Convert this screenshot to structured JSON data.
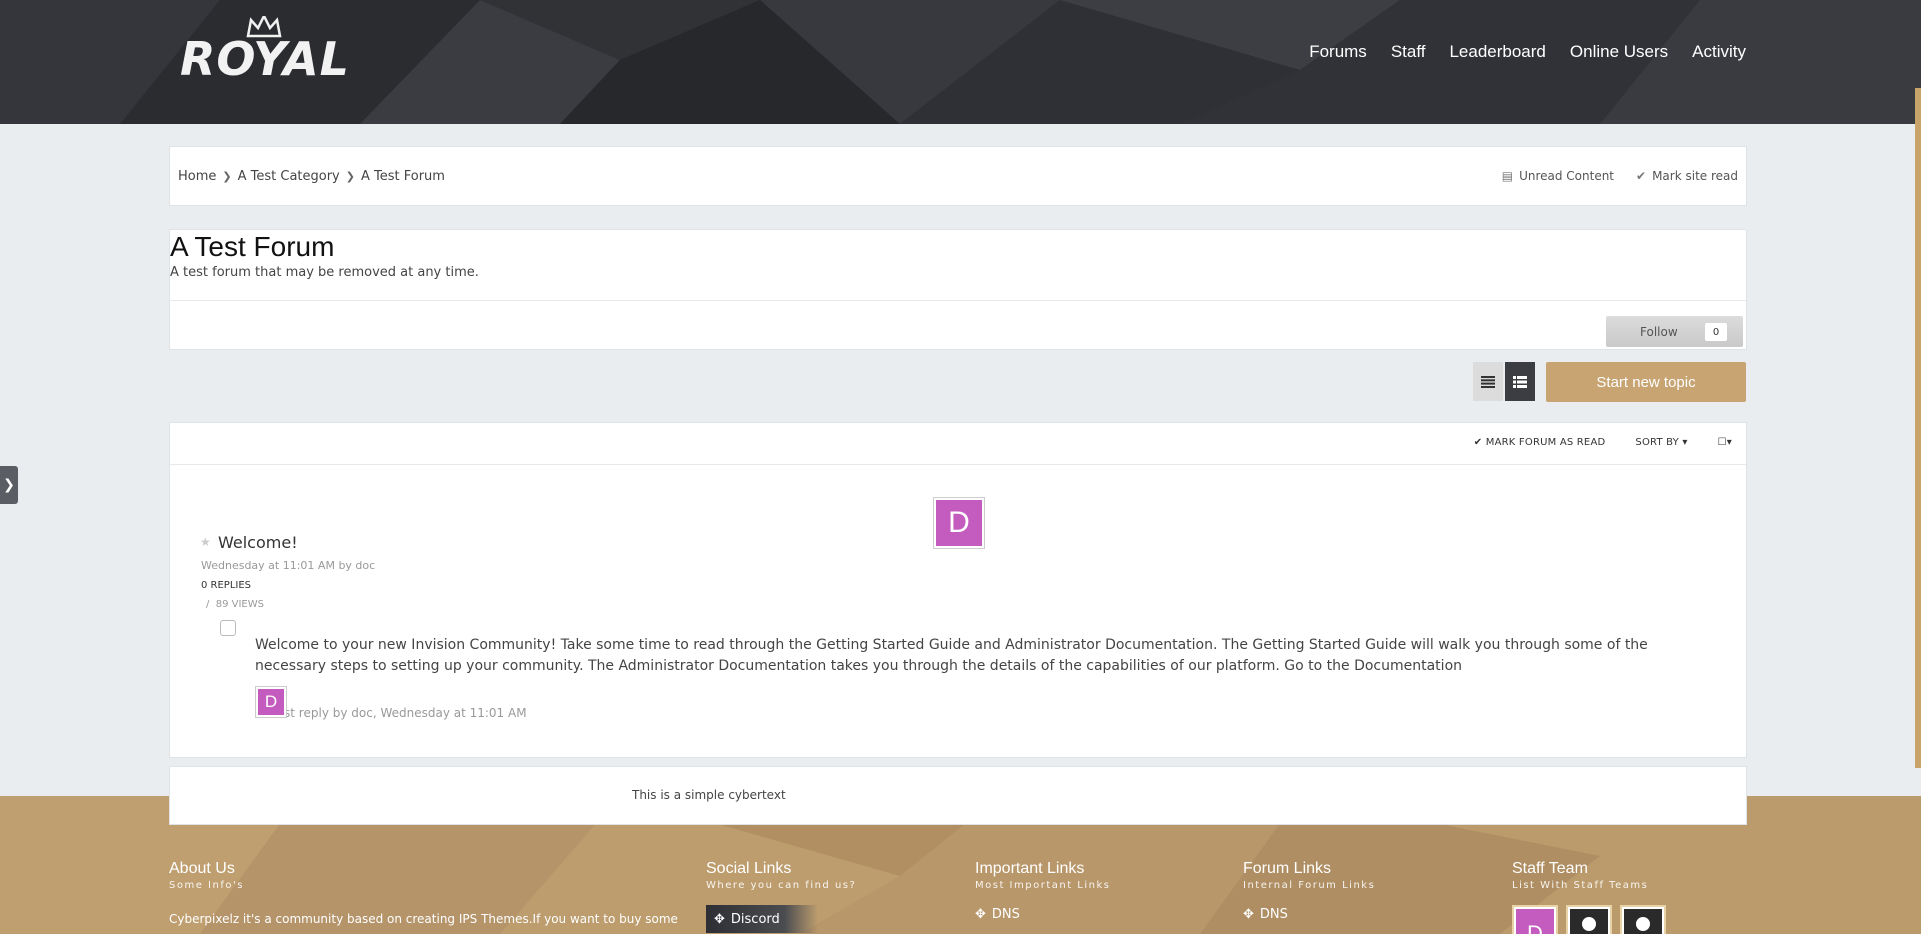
{
  "header": {
    "logo_text": "ROYAL",
    "nav": [
      "Forums",
      "Staff",
      "Leaderboard",
      "Online Users",
      "Activity"
    ]
  },
  "breadcrumb": {
    "items": [
      "Home",
      "A Test Category",
      "A Test Forum"
    ],
    "unread_label": "Unread Content",
    "mark_read_label": "Mark site read"
  },
  "forum": {
    "title": "A Test Forum",
    "description": "A test forum that may be removed at any time.",
    "follow_label": "Follow",
    "follow_count": "0",
    "start_topic_label": "Start new topic"
  },
  "list_toolbar": {
    "mark_forum_read": "MARK FORUM AS READ",
    "sort_by": "SORT BY"
  },
  "topic": {
    "title": "Welcome!",
    "meta": "Wednesday at 11:01 AM by doc",
    "replies": "0 REPLIES",
    "views": "89 VIEWS",
    "snippet": "Welcome to your new Invision Community! Take some time to read through the Getting Started Guide and Administrator Documentation. The Getting Started Guide will walk you through some of the necessary steps to setting up your community. The Administrator Documentation takes you through the details of the capabilities of our platform. Go to the Documentation",
    "last_reply": "Last reply by doc, Wednesday at 11:01 AM",
    "avatar_letter": "D"
  },
  "cybertext": "This is a simple cybertext",
  "footer": {
    "about": {
      "title": "About Us",
      "sub": "Some Info's",
      "body": "Cyberpixelz it's a community based on creating IPS Themes.If you want to buy some"
    },
    "social": {
      "title": "Social Links",
      "sub": "Where you can find us?",
      "discord": "Discord"
    },
    "important": {
      "title": "Important Links",
      "sub": "Most Important Links",
      "link": "DNS"
    },
    "forum_links": {
      "title": "Forum Links",
      "sub": "Internal Forum Links",
      "link": "DNS"
    },
    "staff": {
      "title": "Staff Team",
      "sub": "List With Staff Teams",
      "avatar_letter": "D"
    }
  },
  "colors": {
    "header_bg": "#2c2e33",
    "accent": "#c7a471",
    "footer_bg": "#b9996a",
    "avatar": "#c45bbf"
  }
}
